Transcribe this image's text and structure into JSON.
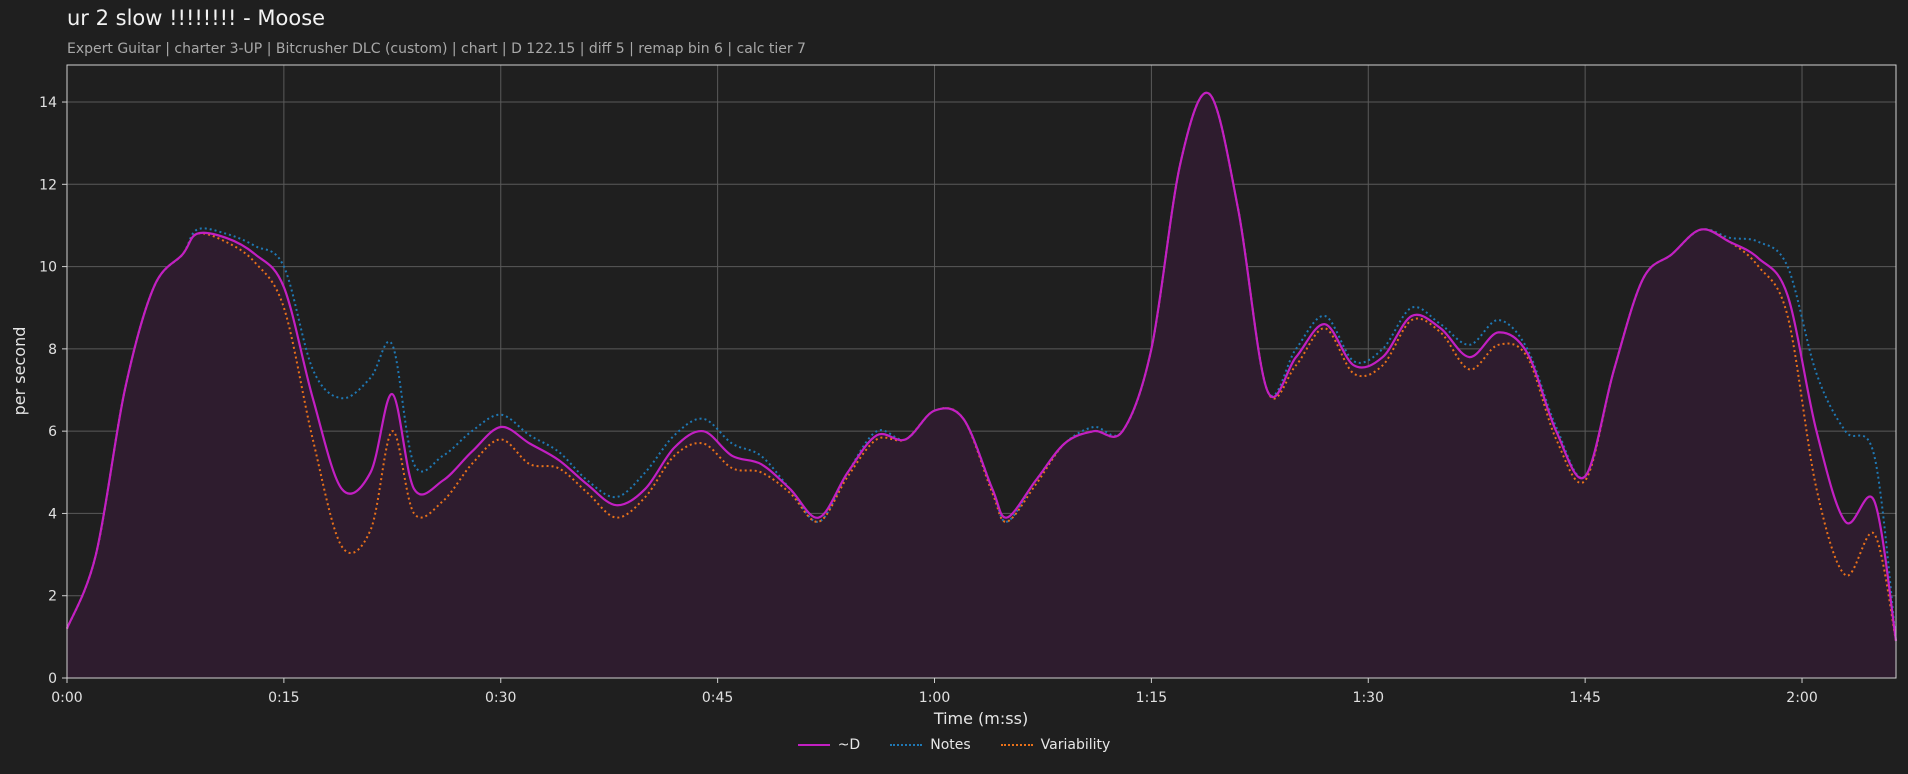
{
  "header": {
    "title": "ur 2 slow !!!!!!!! - Moose",
    "subtitle": "Expert Guitar  |  charter 3-UP  |  Bitcrusher DLC (custom)  |  chart  |  D 122.15  |  diff 5  |  remap bin 6  |  calc tier 7"
  },
  "colors": {
    "background": "#1f1f1f",
    "fill": "#2e1c2e",
    "d": "#c21fc2",
    "notes": "#1f78b4",
    "variability": "#e8711a",
    "grid": "#5a5a5a"
  },
  "chart_data": {
    "type": "line",
    "xlabel": "Time (m:ss)",
    "ylabel": "per second",
    "xlim": [
      "0:00",
      "2:06.5"
    ],
    "ylim": [
      0,
      14.9
    ],
    "grid": true,
    "legend_position": "bottom-center",
    "x_ticks": [
      "0:00",
      "0:15",
      "0:30",
      "0:45",
      "1:00",
      "1:15",
      "1:30",
      "1:45",
      "2:00"
    ],
    "y_ticks": [
      0,
      2,
      4,
      6,
      8,
      10,
      12,
      14
    ],
    "x": [
      "0:00",
      "0:02",
      "0:04",
      "0:06",
      "0:08",
      "0:09",
      "0:11",
      "0:13",
      "0:15",
      "0:17",
      "0:19",
      "0:21",
      "0:22.5",
      "0:24",
      "0:26",
      "0:28",
      "0:30",
      "0:32",
      "0:34",
      "0:36",
      "0:38",
      "0:40",
      "0:42",
      "0:44",
      "0:46",
      "0:48",
      "0:50",
      "0:52",
      "0:54",
      "0:56",
      "0:58",
      "1:00",
      "1:02",
      "1:04",
      "1:05",
      "1:07",
      "1:09",
      "1:11",
      "1:13",
      "1:15",
      "1:17",
      "1:19",
      "1:21",
      "1:23",
      "1:25",
      "1:27",
      "1:29",
      "1:31",
      "1:33",
      "1:35",
      "1:37",
      "1:39",
      "1:41",
      "1:43",
      "1:45",
      "1:47",
      "1:49",
      "1:51",
      "1:53",
      "1:55",
      "1:57",
      "1:59",
      "2:01",
      "2:03",
      "2:05",
      "2:06.5"
    ],
    "series": [
      {
        "name": "~D",
        "style": "solid",
        "values": [
          1.2,
          3.0,
          7.0,
          9.5,
          10.3,
          10.8,
          10.7,
          10.3,
          9.5,
          6.8,
          4.6,
          5.0,
          6.9,
          4.6,
          4.8,
          5.5,
          6.1,
          5.7,
          5.3,
          4.7,
          4.2,
          4.6,
          5.6,
          6.0,
          5.4,
          5.2,
          4.6,
          3.9,
          5.0,
          5.9,
          5.8,
          6.5,
          6.3,
          4.6,
          3.9,
          4.8,
          5.7,
          6.0,
          6.0,
          8.0,
          12.5,
          14.2,
          11.4,
          7.0,
          7.8,
          8.6,
          7.6,
          7.8,
          8.8,
          8.5,
          7.8,
          8.4,
          7.9,
          6.0,
          4.9,
          7.5,
          9.7,
          10.3,
          10.9,
          10.6,
          10.2,
          9.3,
          6.0,
          3.8,
          4.3,
          0.9
        ]
      },
      {
        "name": "Notes",
        "style": "dotted",
        "values": [
          1.2,
          3.0,
          7.0,
          9.5,
          10.3,
          10.9,
          10.8,
          10.5,
          10.0,
          7.5,
          6.8,
          7.3,
          8.1,
          5.2,
          5.4,
          6.0,
          6.4,
          5.9,
          5.5,
          4.8,
          4.4,
          5.0,
          5.9,
          6.3,
          5.7,
          5.4,
          4.6,
          3.8,
          5.0,
          6.0,
          5.8,
          6.5,
          6.3,
          4.6,
          3.8,
          4.8,
          5.7,
          6.1,
          6.0,
          8.0,
          12.5,
          14.2,
          11.4,
          7.0,
          8.0,
          8.8,
          7.7,
          8.0,
          9.0,
          8.6,
          8.1,
          8.7,
          8.0,
          6.1,
          4.9,
          7.5,
          9.7,
          10.3,
          10.9,
          10.7,
          10.6,
          10.0,
          7.4,
          6.0,
          5.4,
          0.9
        ]
      },
      {
        "name": "Variability",
        "style": "dotted",
        "values": [
          1.2,
          3.0,
          7.0,
          9.5,
          10.3,
          10.8,
          10.6,
          10.1,
          9.0,
          5.8,
          3.2,
          3.6,
          6.0,
          4.0,
          4.3,
          5.2,
          5.8,
          5.2,
          5.1,
          4.5,
          3.9,
          4.4,
          5.4,
          5.7,
          5.1,
          5.0,
          4.5,
          3.8,
          4.9,
          5.8,
          5.8,
          6.5,
          6.3,
          4.5,
          3.8,
          4.7,
          5.7,
          6.0,
          6.0,
          8.0,
          12.5,
          14.2,
          11.4,
          7.0,
          7.6,
          8.5,
          7.4,
          7.6,
          8.7,
          8.4,
          7.5,
          8.1,
          7.8,
          5.8,
          4.8,
          7.5,
          9.7,
          10.3,
          10.9,
          10.6,
          10.0,
          8.8,
          4.6,
          2.5,
          3.5,
          0.9
        ]
      }
    ]
  }
}
